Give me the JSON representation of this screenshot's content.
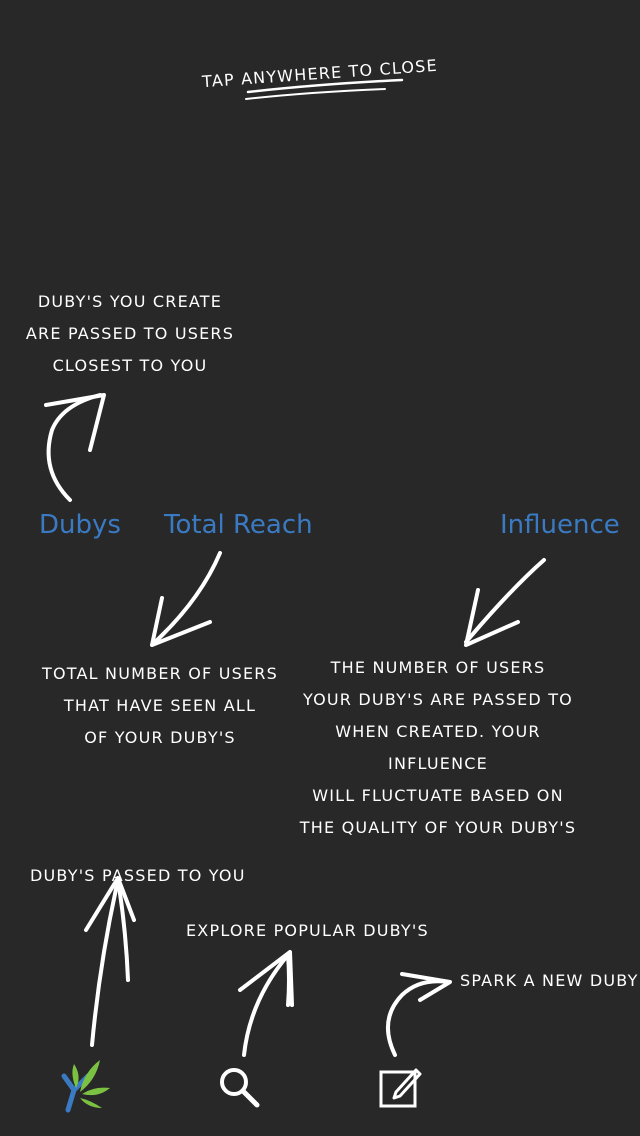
{
  "close_hint": "TAP ANYWHERE TO CLOSE",
  "stats": {
    "dubys": "Dubys",
    "total_reach": "Total Reach",
    "influence": "Influence"
  },
  "notes": {
    "dubys": [
      "DUBY'S YOU CREATE",
      "ARE PASSED TO USERS",
      "CLOSEST TO YOU"
    ],
    "total_reach": [
      "TOTAL NUMBER OF USERS",
      "THAT HAVE SEEN ALL",
      "OF YOUR DUBY'S"
    ],
    "influence": [
      "THE NUMBER OF USERS",
      "YOUR DUBY'S ARE PASSED TO",
      "WHEN CREATED. YOUR INFLUENCE",
      "WILL FLUCTUATE BASED ON",
      "THE QUALITY OF YOUR DUBY'S"
    ],
    "passed": "DUBY'S PASSED TO YOU",
    "explore": "EXPLORE POPULAR DUBY'S",
    "spark": "SPARK A NEW DUBY"
  },
  "tab_icons": [
    "duby-logo-icon",
    "search-icon",
    "compose-icon"
  ],
  "colors": {
    "background": "#282828",
    "accent": "#3a7ac2",
    "leaf": "#7cc242",
    "text": "#ffffff"
  }
}
